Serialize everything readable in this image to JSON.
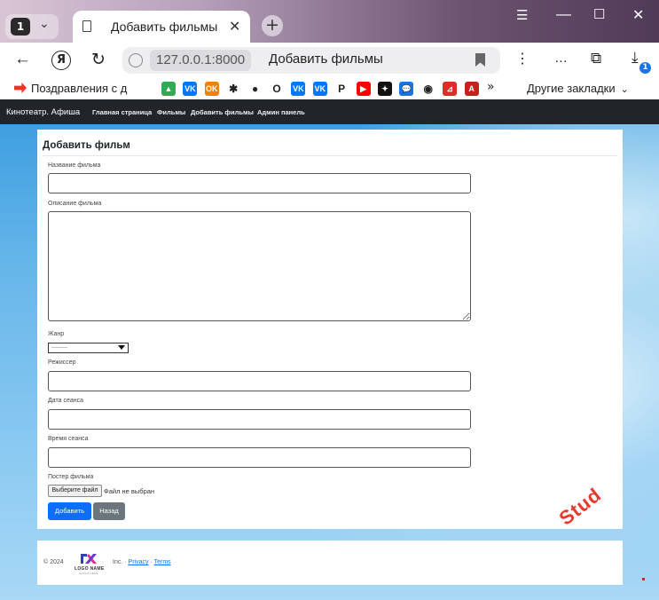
{
  "browser": {
    "tab_count": "1",
    "tab_title": "Добавить фильмы",
    "url_host": "127.0.0.1:8000",
    "page_title": "Добавить фильмы",
    "download_badge": "1",
    "bookmarks_first": "Поздравления с д",
    "bookmarks_other": "Другие закладки",
    "bookmark_icons": [
      {
        "name": "google-drive-icon",
        "color": "#34a853",
        "glyph": "▲"
      },
      {
        "name": "vk-icon",
        "color": "#0077ff",
        "glyph": "VK"
      },
      {
        "name": "odnoklassniki-icon",
        "color": "#ee8208",
        "glyph": "OK"
      },
      {
        "name": "stars-icon",
        "color": "#ffffff",
        "glyph": "✱"
      },
      {
        "name": "colorful-dots-icon",
        "color": "#ffffff",
        "glyph": "●"
      },
      {
        "name": "circle-o-icon",
        "color": "#ffffff",
        "glyph": "O"
      },
      {
        "name": "vk-icon-2",
        "color": "#0077ff",
        "glyph": "VK"
      },
      {
        "name": "vk-icon-3",
        "color": "#0077ff",
        "glyph": "VK"
      },
      {
        "name": "p-icon",
        "color": "#ffffff",
        "glyph": "P"
      },
      {
        "name": "youtube-icon",
        "color": "#ff0000",
        "glyph": "▶"
      },
      {
        "name": "compass-icon",
        "color": "#111111",
        "glyph": "✦"
      },
      {
        "name": "chat-icon",
        "color": "#1a73e8",
        "glyph": "💬"
      },
      {
        "name": "github-icon",
        "color": "#ffffff",
        "glyph": "◉"
      },
      {
        "name": "pdf-icon",
        "color": "#d93025",
        "glyph": "⊿"
      },
      {
        "name": "acrobat-icon",
        "color": "#c5221f",
        "glyph": "A"
      }
    ]
  },
  "site": {
    "brand": "Кинотеатр. Афиша",
    "nav": [
      "Главная страница",
      "Фильмы",
      "Добавить фильмы",
      "Админ панель"
    ]
  },
  "form": {
    "title": "Добавить фильм",
    "fields": {
      "name_label": "Название фильма",
      "description_label": "Описание фильма",
      "genre_label": "Жанр",
      "genre_selected": "---------",
      "director_label": "Режиссер",
      "date_label": "Дата сеанса",
      "time_label": "Время сеанса",
      "poster_label": "Постер фильма",
      "file_button": "Выберите файл",
      "file_status": "Файл не выбран"
    },
    "submit": "Добавить",
    "back": "Назад"
  },
  "footer": {
    "copyright": "© 2024",
    "logo_name": "LOGO NAME",
    "logo_sub": "SLOGAN HERE",
    "inc": "Inc.",
    "privacy": "Privacy",
    "terms": "Terms"
  },
  "watermark": "Stud",
  "colors": {
    "nav_bg": "#212529",
    "primary": "#0d6efd",
    "secondary": "#6c757d",
    "watermark": "#e8392f"
  }
}
